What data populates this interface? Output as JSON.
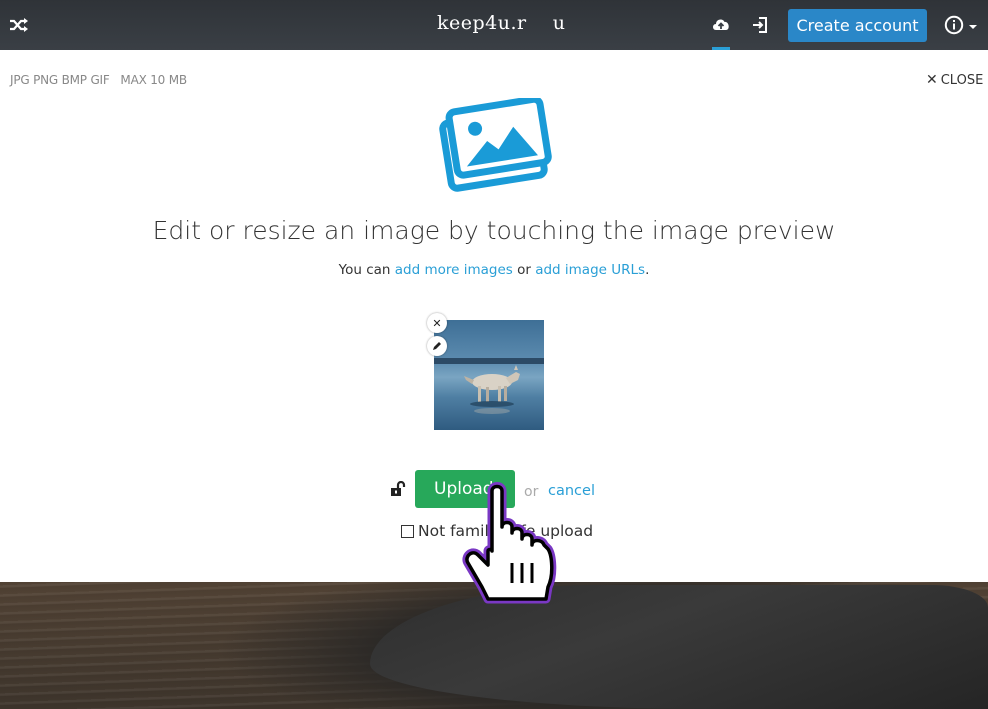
{
  "header": {
    "brand": "keep4u.r    u",
    "create_account_label": "Create account",
    "icons": {
      "random": "shuffle-icon",
      "upload": "cloud-upload-icon",
      "login": "sign-in-icon",
      "info": "info-icon"
    },
    "accent_color": "#2a87c8"
  },
  "uploader": {
    "formats_text": "JPG PNG BMP GIF   MAX 10 MB",
    "close_label": "CLOSE",
    "headline": "Edit or resize an image by touching the image preview",
    "sub_prefix": "You can ",
    "add_more_link": "add more images",
    "or_word": " or ",
    "add_urls_link": "add image URLs",
    "sub_suffix": ".",
    "hero_icon": "images-icon",
    "hero_color": "#1a9bd7"
  },
  "queue": {
    "thumbnail_alt": "wolf on frozen lake",
    "remove_icon": "close-icon",
    "edit_icon": "pencil-icon"
  },
  "actions": {
    "privacy_icon": "unlock-icon",
    "upload_label": "Upload",
    "or_label": "or",
    "cancel_label": "cancel",
    "nsfw_label": "Not family safe upload",
    "nsfw_checked": false,
    "upload_color": "#27a85a"
  }
}
